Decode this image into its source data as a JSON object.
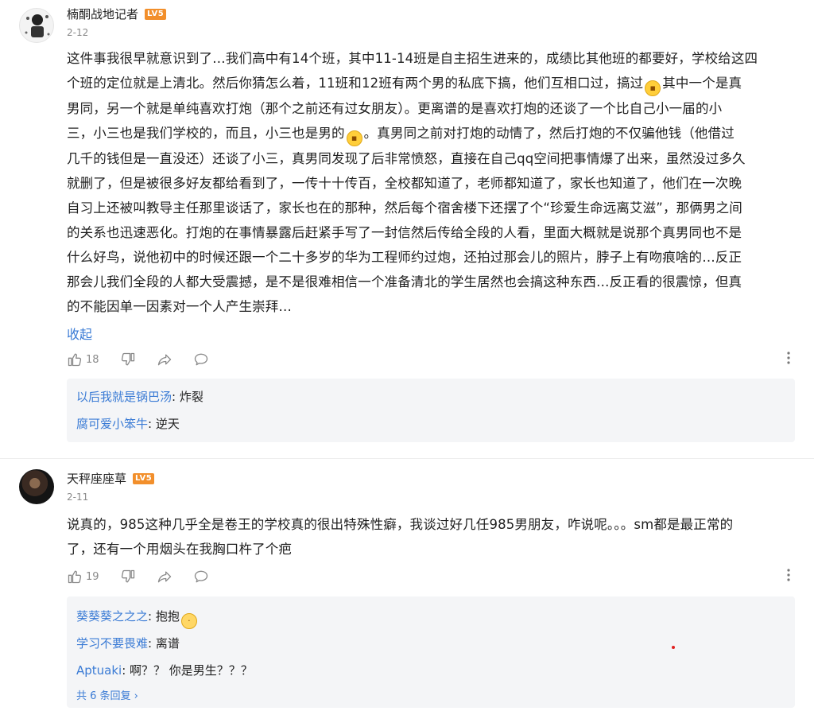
{
  "comments": [
    {
      "username": "楠酮战地记者",
      "level": "LV5",
      "date": "2-12",
      "lines": [
        "这件事我很早就意识到了…我们高中有14个班，其中11-14班是自主招生进来的，成绩比其他班的都要好，学校给这四",
        "个班的定位就是上清北。然后你猜怎么着，11班和12班有两个男的私底下搞，他们互相口过，搞过",
        "其中一个是真",
        "男同，另一个就是单纯喜欢打炮（那个之前还有过女朋友）。更离谱的是喜欢打炮的还谈了一个比自己小一届的小",
        "三，小三也是我们学校的，而且，小三也是男的",
        "。真男同之前对打炮的动情了，然后打炮的不仅骗他钱（他借过",
        "几千的钱但是一直没还）还谈了小三，真男同发现了后非常愤怒，直接在自己qq空间把事情爆了出来，虽然没过多久",
        "就删了，但是被很多好友都给看到了，一传十十传百，全校都知道了，老师都知道了，家长也知道了，他们在一次晚",
        "自习上还被叫教导主任那里谈话了，家长也在的那种，然后每个宿舍楼下还摆了个“珍爱生命远离艾滋”，那俩男之间",
        "的关系也迅速恶化。打炮的在事情暴露后赶紧手写了一封信然后传给全段的人看，里面大概就是说那个真男同也不是",
        "什么好鸟，说他初中的时候还跟一个二十多岁的华为工程师约过炮，还拍过那会儿的照片，脖子上有吻痕啥的…反正",
        "那会儿我们全段的人都大受震撼，是不是很难相信一个准备清北的学生居然也会搞这种东西…反正看的很震惊，但真",
        "的不能因单一因素对一个人产生崇拜…"
      ],
      "fold_label": "收起",
      "like_count": "18",
      "replies": [
        {
          "name": "以后我就是锅巴汤",
          "text": ": 炸裂"
        },
        {
          "name": "腐可爱小笨牛",
          "text": ": 逆天"
        }
      ]
    },
    {
      "username": "天秤座座草",
      "level": "LV5",
      "date": "2-11",
      "lines": [
        "说真的，985这种几乎全是卷王的学校真的很出特殊性癖，我谈过好几任985男朋友，咋说呢。。。sm都是最正常的",
        "了，还有一个用烟头在我胸口杵了个疤"
      ],
      "like_count": "19",
      "replies": [
        {
          "name": "葵葵葵之之之",
          "text": ": 抱抱"
        },
        {
          "name": "学习不要畏难",
          "text": ": 离谱"
        },
        {
          "name": "Aptuaki",
          "text": ": 啊？？ 你是男生？？？"
        }
      ],
      "more_replies_label": "共 6 条回复 ›"
    }
  ],
  "icons": {
    "like": "thumbs-up-icon",
    "dislike": "thumbs-down-icon",
    "share": "share-icon",
    "comment": "comment-icon",
    "more": "more-vertical-icon",
    "emoji_grin": "grinning-emoji",
    "emoji_sad": "sad-emoji"
  },
  "colors": {
    "link": "#3a7bd5",
    "level_badge": "#f28f2b",
    "reply_bg": "#f4f5f7"
  }
}
